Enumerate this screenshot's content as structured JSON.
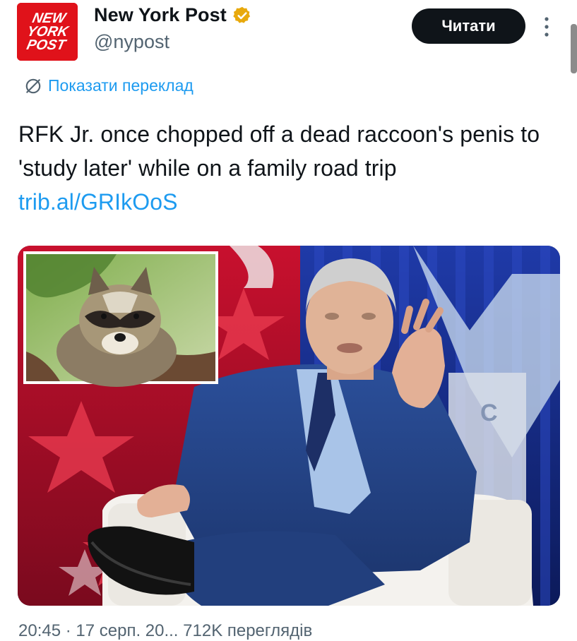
{
  "account": {
    "display_name": "New York Post",
    "handle": "@nypost",
    "verified": "gold-check-icon",
    "avatar_logo_lines": [
      "NEW",
      "YORK",
      "POST"
    ],
    "avatar_color": "#e0121a"
  },
  "follow_button": {
    "label": "Читати"
  },
  "translate": {
    "label": "Показати переклад",
    "icon": "globe-slash-icon"
  },
  "tweet": {
    "text": "RFK Jr. once chopped off a dead raccoon's penis to 'study later' while on a family road trip",
    "link": "trib.al/GRIkOoS"
  },
  "media": {
    "description_icons": [
      "raccoon-inset-photo",
      "speaker-in-armchair-photo"
    ],
    "stage_logo_fragment": "C"
  },
  "meta": {
    "partial_text": "20:45 · 17 серп. 20... 712K переглядів"
  },
  "colors": {
    "link": "#1d9bf0",
    "button_bg": "#0f1419",
    "muted": "#536471",
    "verified": "#e8a90c"
  }
}
